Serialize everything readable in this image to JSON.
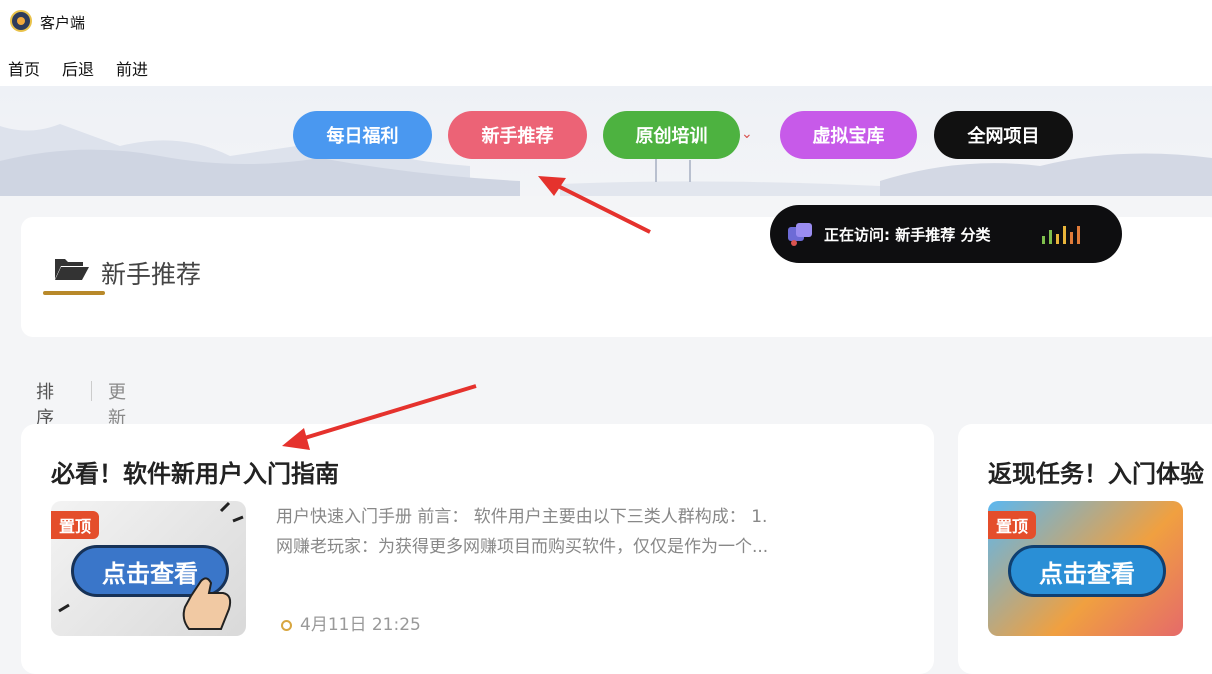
{
  "window": {
    "title": "客户端"
  },
  "menu": {
    "home": "首页",
    "back": "后退",
    "forward": "前进"
  },
  "nav": [
    {
      "label": "每日福利",
      "color": "#4a98f0"
    },
    {
      "label": "新手推荐",
      "color": "#ec6376"
    },
    {
      "label": "原创培训",
      "color": "#4db240"
    },
    {
      "label": "虚拟宝库",
      "color": "#c75ae9"
    },
    {
      "label": "全网项目",
      "color": "#111111"
    }
  ],
  "visit": {
    "text": "正在访问: 新手推荐 分类"
  },
  "category": {
    "title": "新手推荐"
  },
  "sort": {
    "label": "排序",
    "option": "更新"
  },
  "posts": [
    {
      "title": "必看！软件新用户入门指南",
      "pin": "置顶",
      "thumb_button": "点击查看",
      "excerpt_line1": "用户快速入门手册 前言： 软件用户主要由以下三类人群构成： 1.",
      "excerpt_line2": "网赚老玩家：为获得更多网赚项目而购买软件，仅仅是作为一个...",
      "date": "4月11日 21:25"
    },
    {
      "title": "返现任务！入门体验",
      "pin": "置顶",
      "thumb_button": "点击查看"
    }
  ],
  "colors": {
    "accent_gold": "#b8892a",
    "annotation_arrow": "#e5322d"
  }
}
